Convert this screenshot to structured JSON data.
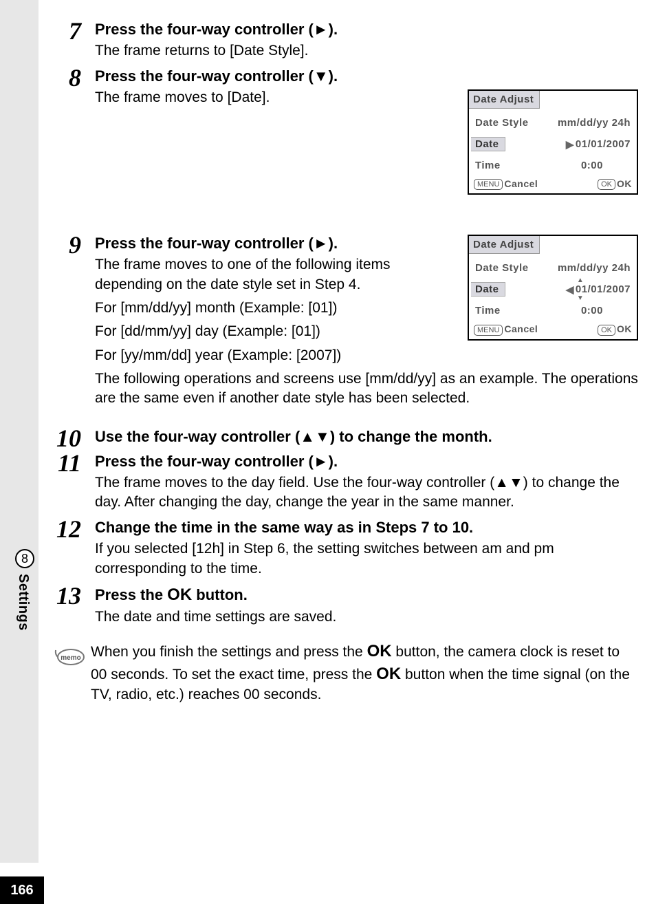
{
  "page_number": "166",
  "side": {
    "section_number": "8",
    "section_label": "Settings"
  },
  "steps": [
    {
      "num": "7",
      "title_parts": [
        "Press the four-way controller (",
        "►",
        ")."
      ],
      "desc": [
        "The frame returns to [Date Style]."
      ]
    },
    {
      "num": "8",
      "title_parts": [
        "Press the four-way controller (",
        "▼",
        ")."
      ],
      "desc": [
        "The frame moves to [Date]."
      ]
    },
    {
      "num": "9",
      "title_parts": [
        "Press the four-way controller (",
        "►",
        ")."
      ],
      "desc": [
        "The frame moves to one of the following items depending on the date style set in Step 4.",
        "For [mm/dd/yy] month (Example: [01])",
        "For [dd/mm/yy] day (Example: [01])",
        "For [yy/mm/dd] year (Example: [2007])",
        "The following operations and screens use [mm/dd/yy] as an example. The operations are the same even if another date style has been selected."
      ]
    },
    {
      "num": "10",
      "title_parts": [
        "Use the four-way controller (",
        "▲▼",
        ") to change the month."
      ],
      "desc": []
    },
    {
      "num": "11",
      "title_parts": [
        "Press the four-way controller (",
        "►",
        ")."
      ],
      "desc": [
        "The frame moves to the day field. Use the four-way controller (▲▼) to change the day. After changing the day, change the year in the same manner."
      ]
    },
    {
      "num": "12",
      "title_parts": [
        "Change the time in the same way as in Steps 7 to 10."
      ],
      "desc": [
        "If you selected [12h] in Step 6, the setting switches between am and pm corresponding to the time."
      ]
    },
    {
      "num": "13",
      "title_parts": [
        "Press the ",
        "OK",
        " button."
      ],
      "desc": [
        "The date and time settings are saved."
      ]
    }
  ],
  "memo": {
    "label": "memo",
    "text_parts": [
      "When you finish the settings and press the ",
      "OK",
      " button, the camera clock is reset to 00 seconds. To set the exact time, press the ",
      "OK",
      " button when the time signal (on the TV, radio, etc.) reaches 00 seconds."
    ]
  },
  "lcd1": {
    "title": "Date Adjust",
    "rows": {
      "date_style": {
        "label": "Date Style",
        "value": "mm/dd/yy 24h"
      },
      "date": {
        "label": "Date",
        "value": "01/01/2007",
        "cursor": "right",
        "selected": true
      },
      "time": {
        "label": "Time",
        "value": "0:00"
      }
    },
    "footer": {
      "menu": "MENU",
      "cancel": "Cancel",
      "ok_box": "OK",
      "ok": "OK"
    }
  },
  "lcd2": {
    "title": "Date Adjust",
    "rows": {
      "date_style": {
        "label": "Date Style",
        "value": "mm/dd/yy 24h"
      },
      "date": {
        "label": "Date",
        "hl": "01",
        "rest": "/01/2007",
        "cursor": "left",
        "selected": true
      },
      "time": {
        "label": "Time",
        "value": "0:00"
      }
    },
    "footer": {
      "menu": "MENU",
      "cancel": "Cancel",
      "ok_box": "OK",
      "ok": "OK"
    }
  }
}
